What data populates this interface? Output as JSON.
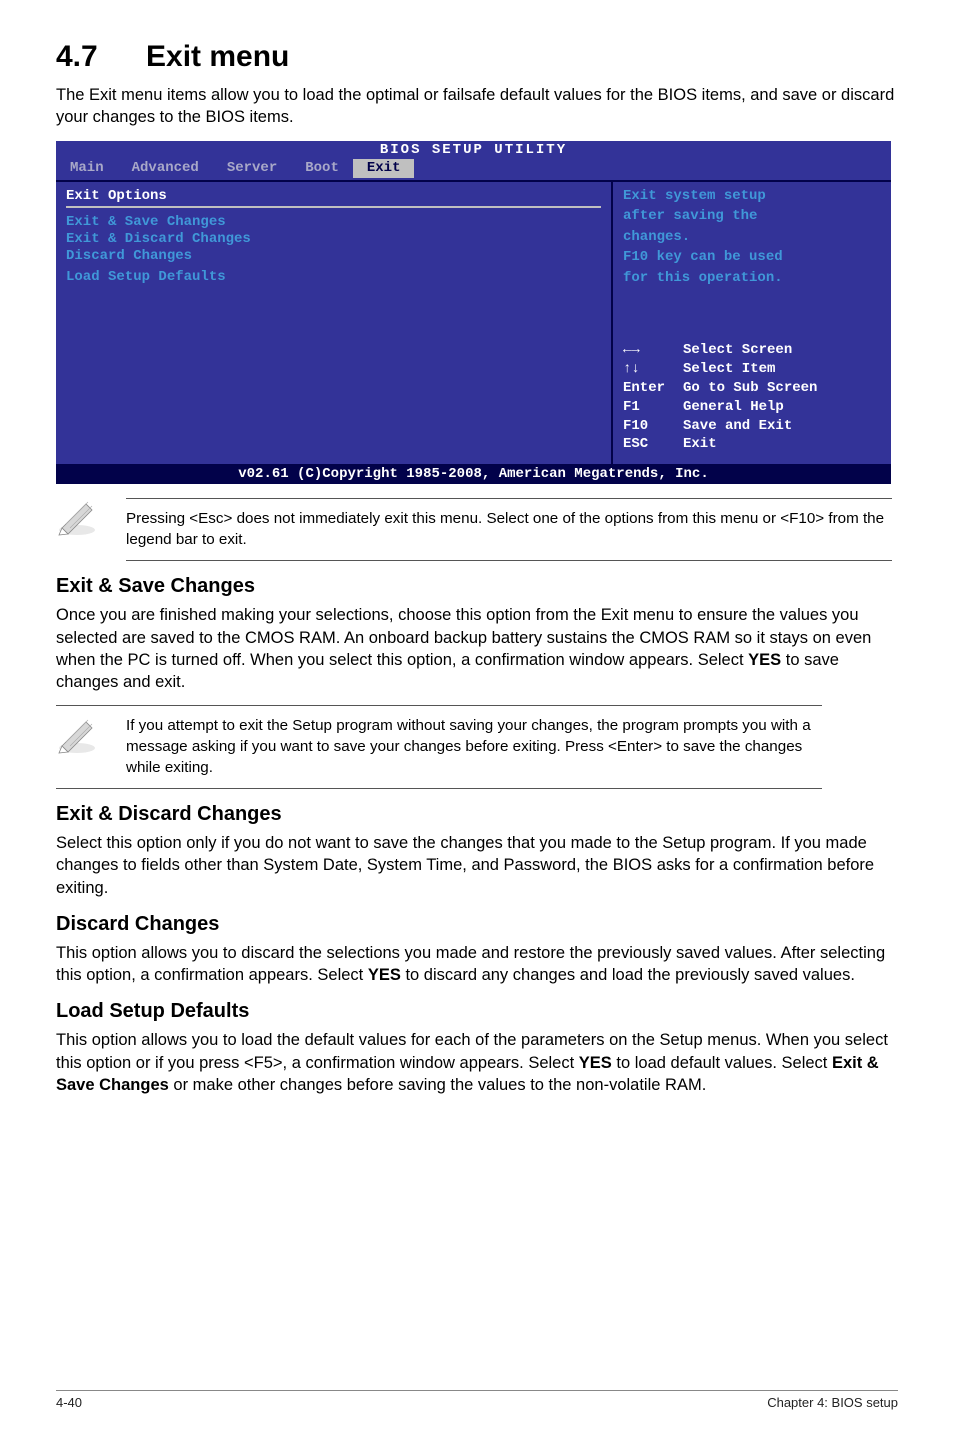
{
  "heading": {
    "num": "4.7",
    "title": "Exit menu"
  },
  "intro": "The Exit menu items allow you to load the optimal or failsafe default values for the BIOS items, and save or discard your changes to the BIOS items.",
  "bios": {
    "title": "BIOS SETUP UTILITY",
    "tabs": [
      "Main",
      "Advanced",
      "Server",
      "Boot",
      "Exit"
    ],
    "active_tab": "Exit",
    "left_heading": "Exit Options",
    "options": [
      "Exit & Save Changes",
      "Exit & Discard Changes",
      "Discard Changes",
      "",
      "Load Setup Defaults"
    ],
    "help": [
      "Exit system setup",
      "after saving the",
      "changes.",
      "",
      "F10 key can be used",
      "for this operation."
    ],
    "nav": [
      {
        "key_class": "arrow-lr",
        "key": "",
        "label": "Select Screen"
      },
      {
        "key_class": "arrow-ud",
        "key": "",
        "label": "Select Item"
      },
      {
        "key_class": "",
        "key": "Enter",
        "label": "Go to Sub Screen"
      },
      {
        "key_class": "",
        "key": "F1",
        "label": "General Help"
      },
      {
        "key_class": "",
        "key": "F10",
        "label": "Save and Exit"
      },
      {
        "key_class": "",
        "key": "ESC",
        "label": "Exit"
      }
    ],
    "footer": "v02.61 (C)Copyright 1985-2008, American Megatrends, Inc."
  },
  "note1": "Pressing <Esc> does not immediately exit this menu. Select one of the options from this menu or <F10> from the legend bar to exit.",
  "sections": {
    "s1": {
      "h": "Exit & Save Changes",
      "p": "Once you are finished making your selections, choose this option from the Exit menu to ensure the values you selected are saved to the CMOS RAM. An onboard backup battery sustains the CMOS RAM so it stays on even when the PC is turned off. When you select this option, a confirmation window appears. Select YES to save changes and exit."
    },
    "s2": {
      "h": "Exit & Discard Changes",
      "p": "Select this option only if you do not want to save the changes that you made to the Setup program. If you made changes to fields other than System Date, System Time, and Password, the BIOS asks for a confirmation before exiting."
    },
    "s3": {
      "h": "Discard Changes",
      "p": "This option allows you to discard the selections you made and restore the previously saved values. After selecting this option, a confirmation appears. Select YES to discard any changes and load the previously saved values."
    },
    "s4": {
      "h": "Load Setup Defaults",
      "p": "This option allows you to load the default values for each of the parameters on the Setup menus. When you select this option or if you press <F5>, a confirmation window appears. Select YES to load default values. Select Exit & Save Changes or make other changes before saving the values to the non-volatile RAM."
    }
  },
  "note2": "If you attempt to exit the Setup program without saving your changes, the program prompts you with a message asking if you want to save your changes before exiting. Press <Enter> to save the changes while exiting.",
  "footer": {
    "left": "4-40",
    "right": "Chapter 4: BIOS setup"
  }
}
